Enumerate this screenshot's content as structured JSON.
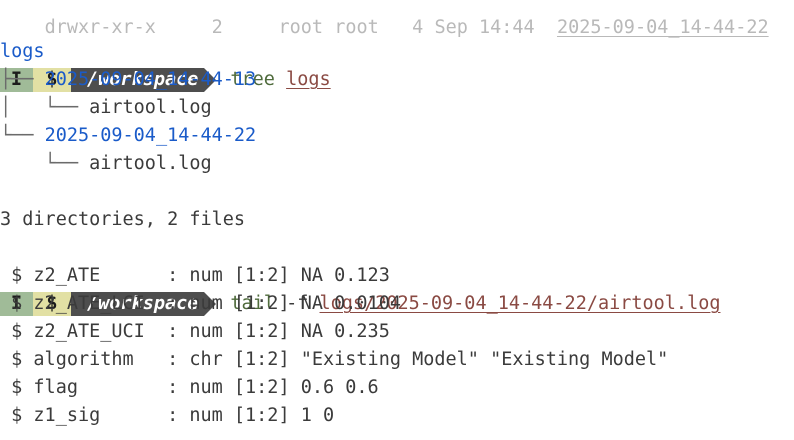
{
  "header_cut": {
    "perms": "drwxr-xr-x",
    "links": "2",
    "owner": "root root",
    "date": "4 Sep 14:44",
    "name": "2025-09-04_14-44-22"
  },
  "prompt": {
    "mode": "I",
    "symbol": "$",
    "cwd": "/workspace"
  },
  "cmd1": {
    "program": "tree",
    "arg": "logs"
  },
  "tree": {
    "root": "logs",
    "items": [
      {
        "prefix": "├── ",
        "name": "2025-09-04_14-44-13",
        "type": "dir"
      },
      {
        "prefix": "│   └── ",
        "name": "airtool.log",
        "type": "file"
      },
      {
        "prefix": "└── ",
        "name": "2025-09-04_14-44-22",
        "type": "dir"
      },
      {
        "prefix": "    └── ",
        "name": "airtool.log",
        "type": "file"
      }
    ],
    "summary": "3 directories, 2 files"
  },
  "cmd2": {
    "program": "tail",
    "flag": "-f",
    "arg": "logs/2025-09-04_14-44-22/airtool.log"
  },
  "output": [
    " $ z2_ATE      : num [1:2] NA 0.123",
    " $ z2_ATE_LCI  : num [1:2] NA 0.0104",
    " $ z2_ATE_UCI  : num [1:2] NA 0.235",
    " $ algorithm   : chr [1:2] \"Existing Model\" \"Existing Model\"",
    " $ flag        : num [1:2] 0.6 0.6",
    " $ z1_sig      : num [1:2] 1 0"
  ],
  "colors": {
    "dir": "#1a5bc9",
    "mode_bg": "#a0bb98",
    "symbol_bg": "#e2e0a4",
    "cwd_bg": "#4e4e4e"
  }
}
